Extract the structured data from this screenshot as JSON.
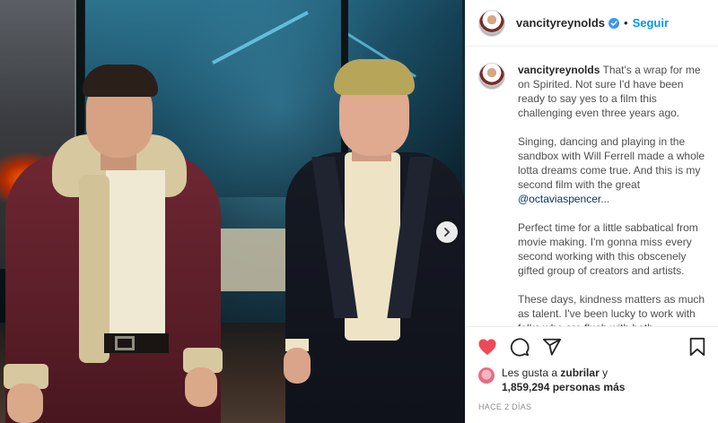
{
  "post": {
    "username": "vancityreynolds",
    "separator": "•",
    "follow_label": "Seguir",
    "caption": {
      "username": "vancityreynolds",
      "p1": "That's a wrap for me on Spirited. Not sure I'd have been ready to say yes to a film this challenging even three years ago.",
      "p2_before": "Singing, dancing and playing in the sandbox with Will Ferrell made a whole lotta dreams come true. And this is my second film with the great ",
      "mention": "@octaviaspencer",
      "p2_after": "...",
      "p3": "Perfect time for a little sabbatical from movie making. I'm gonna miss every second working with this obscenely gifted group of creators and artists.",
      "p4": "These days, kindness matters as much as talent. I've been lucky to work with folks who are flush with both."
    },
    "likes": {
      "prefix": "Les gusta a ",
      "liker": "zubrilar",
      "conj": " y",
      "count": "1,859,294 personas más"
    },
    "timestamp": "HACE 2 DÍAS"
  },
  "colors": {
    "accent": "#0095f6",
    "like_red": "#ed4956",
    "verified_blue": "#3897f0"
  },
  "icons": {
    "like": "heart-filled-icon",
    "comment": "comment-bubble-icon",
    "share": "paper-plane-icon",
    "save": "bookmark-icon",
    "next": "chevron-right-icon",
    "verified": "verified-badge-icon"
  }
}
